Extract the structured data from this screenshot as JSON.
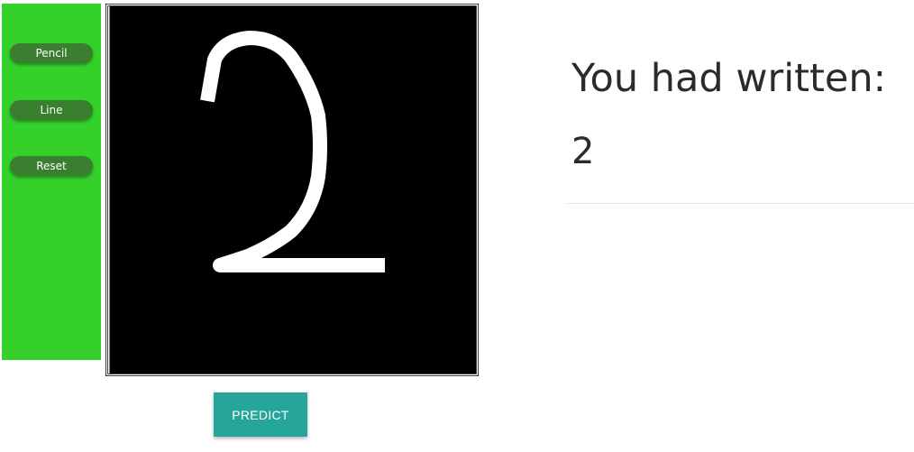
{
  "toolbar": {
    "background": "#33d12a",
    "button_color": "#3a7f2f",
    "pencil_label": "Pencil",
    "line_label": "Line",
    "reset_label": "Reset"
  },
  "canvas": {
    "background": "#000000",
    "stroke_color": "#ffffff",
    "drawn_digit": "2"
  },
  "predict": {
    "label": "PREDICT",
    "color": "#26a69a"
  },
  "result": {
    "heading": "You had written:",
    "digit": "2"
  }
}
